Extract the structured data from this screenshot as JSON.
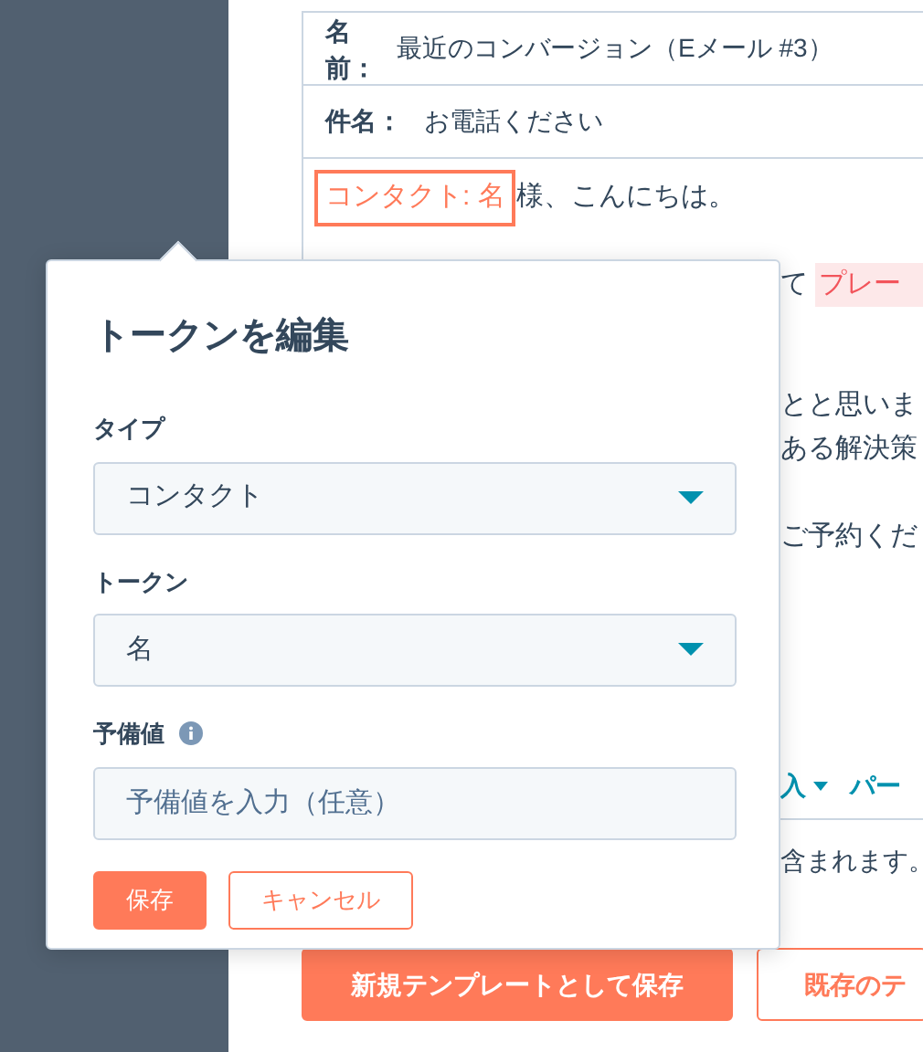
{
  "email": {
    "name_label": "名前：",
    "name_value": "最近のコンバージョン（Eメール #3）",
    "subject_label": "件名：",
    "subject_value": "お電話ください",
    "token": "コンタクト: 名",
    "greeting": "様、こんにちは。",
    "lines": [
      {
        "kind": "highlight",
        "text": "て",
        "highlight": "プレー"
      },
      {
        "kind": "text",
        "text": "とと思いま"
      },
      {
        "kind": "text",
        "text": "ある解決策"
      },
      {
        "kind": "gap"
      },
      {
        "kind": "text",
        "text": "ご予約くだ"
      }
    ],
    "toolbar": [
      {
        "label": "入",
        "dropdown": true
      },
      {
        "label": "パー",
        "dropdown": false
      }
    ],
    "footer_note": "含まれます。",
    "buttons": [
      {
        "label": "新規テンプレートとして保存",
        "primary": true
      },
      {
        "label": "既存のテ",
        "primary": false
      }
    ]
  },
  "popover": {
    "title": "トークンを編集",
    "fields": [
      {
        "kind": "select",
        "label": "タイプ",
        "value": "コンタクト"
      },
      {
        "kind": "select",
        "label": "トークン",
        "value": "名"
      },
      {
        "kind": "input",
        "label": "予備値",
        "info": true,
        "placeholder": "予備値を入力（任意）"
      }
    ],
    "buttons": [
      {
        "label": "保存",
        "primary": true
      },
      {
        "label": "キャンセル",
        "primary": false
      }
    ]
  }
}
